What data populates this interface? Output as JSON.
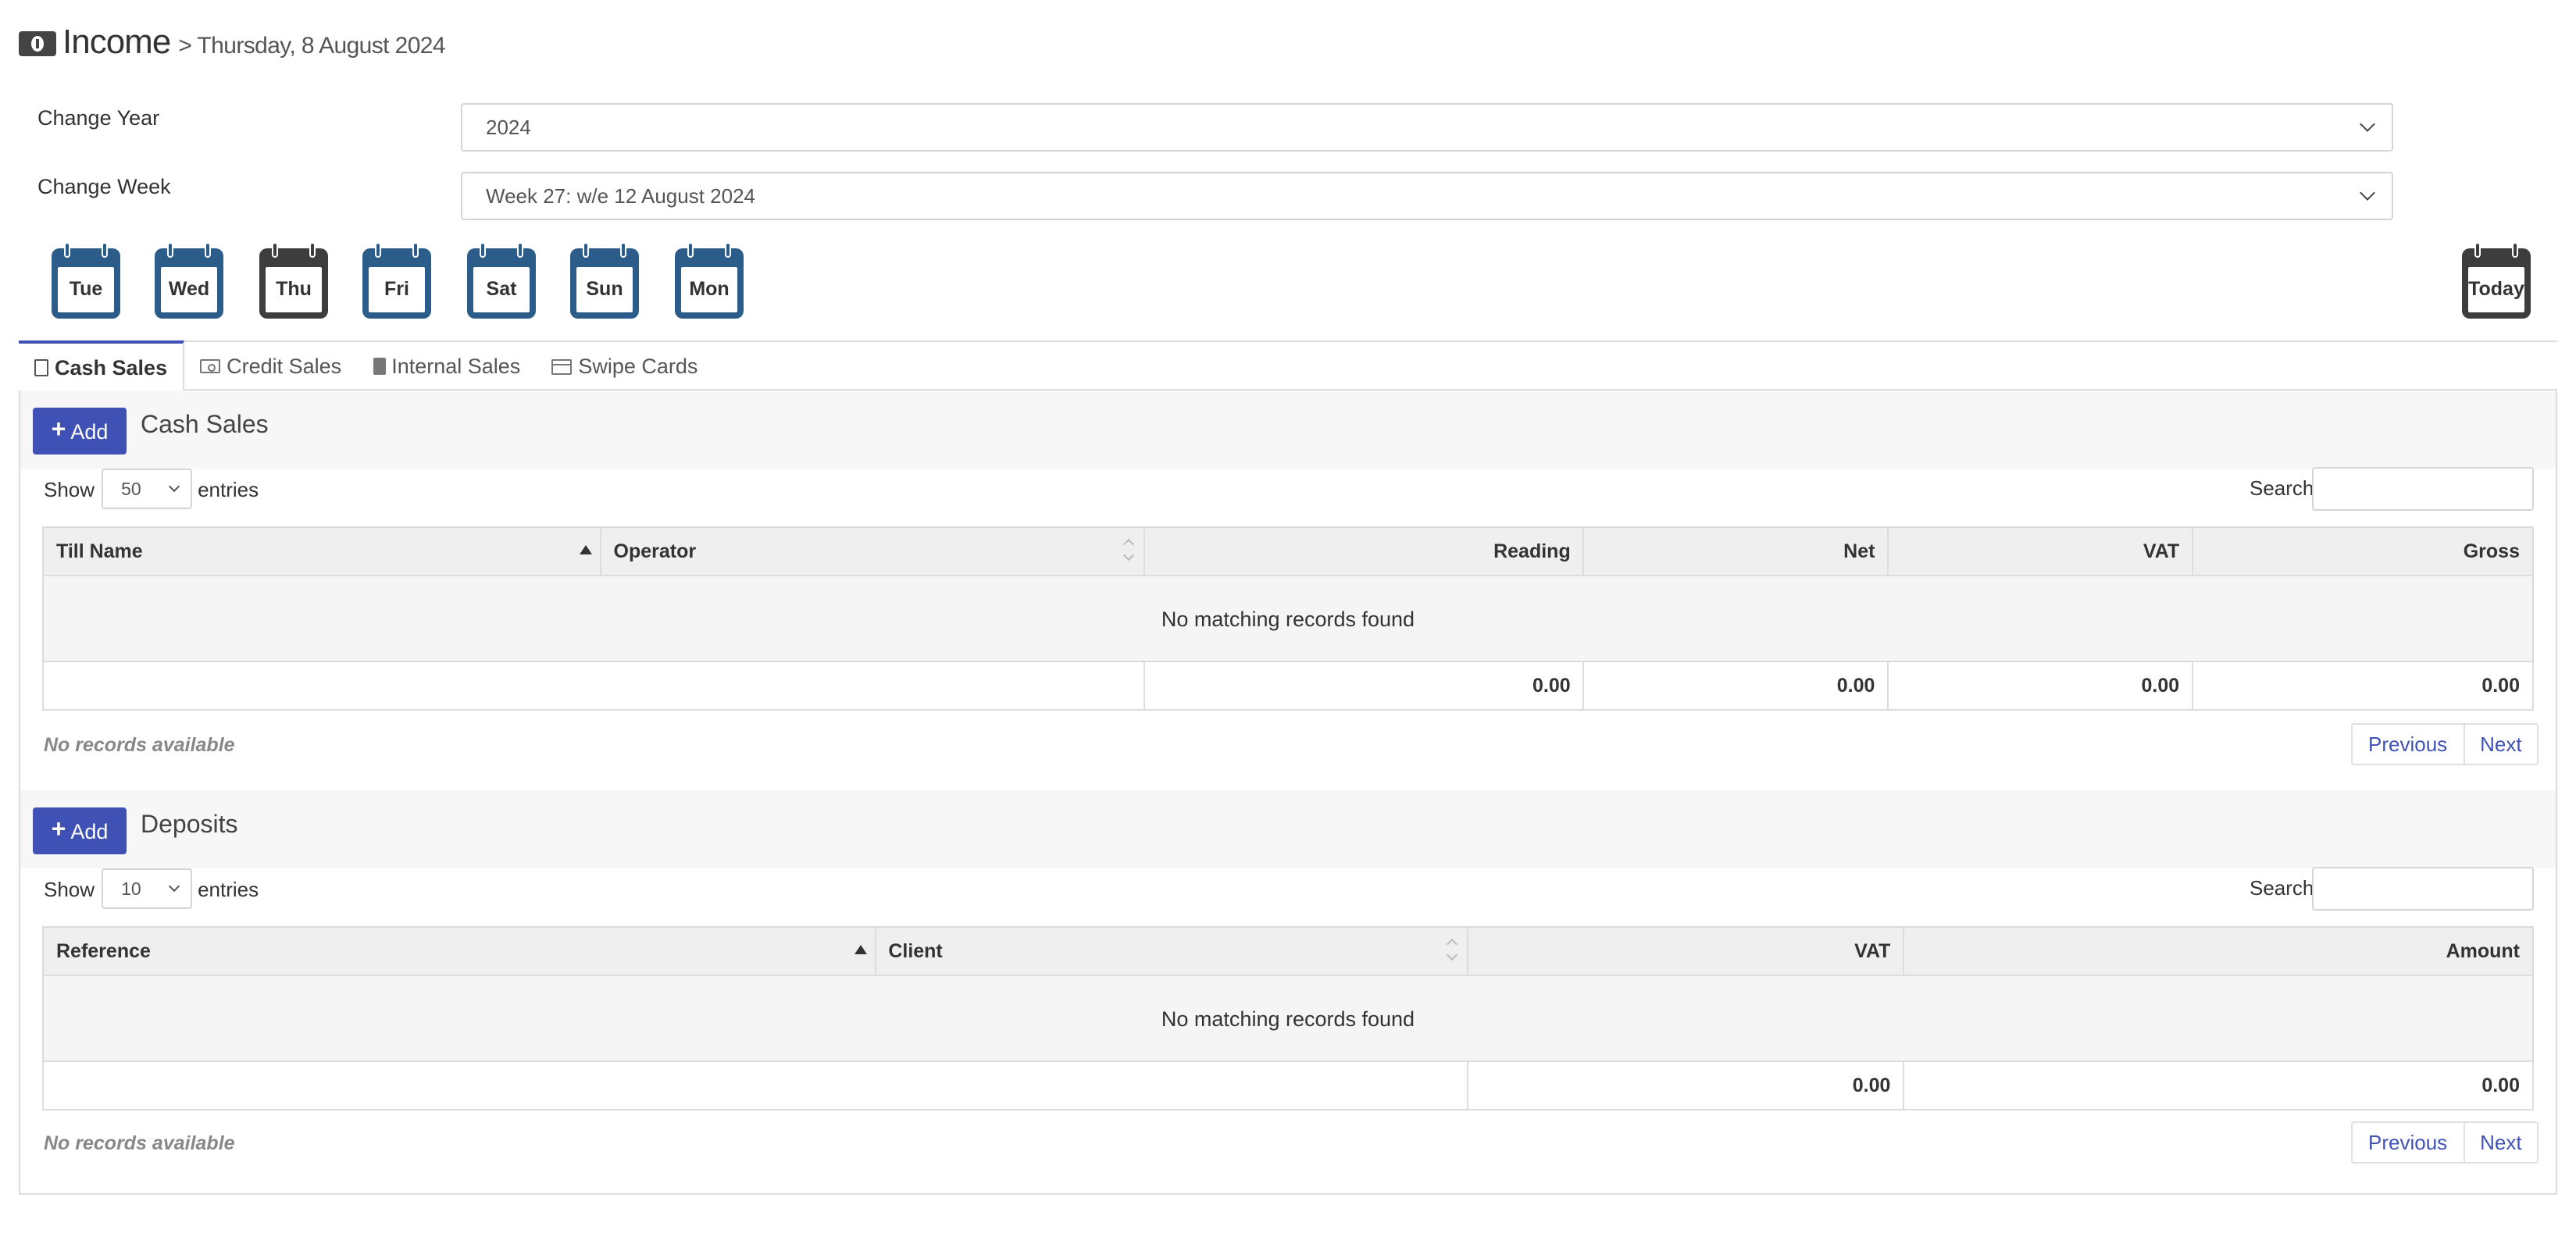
{
  "header": {
    "title": "Income",
    "subtitle": "> Thursday, 8 August 2024",
    "icon": "money-icon"
  },
  "filters": {
    "year_label": "Change Year",
    "year_value": "2024",
    "week_label": "Change Week",
    "week_value": "Week 27: w/e 12 August 2024"
  },
  "days": [
    "Tue",
    "Wed",
    "Thu",
    "Fri",
    "Sat",
    "Sun",
    "Mon"
  ],
  "today_label": "Today",
  "colors": {
    "accent": "#3f51b5",
    "calendar": "#2b5c8a",
    "calendar_active": "#3d3d3d"
  },
  "tabs": [
    {
      "label": "Cash Sales",
      "icon": "document-icon",
      "active": true
    },
    {
      "label": "Credit Sales",
      "icon": "cash-icon"
    },
    {
      "label": "Internal Sales",
      "icon": "copy-icon"
    },
    {
      "label": "Swipe Cards",
      "icon": "credit-card-icon"
    }
  ],
  "cash_sales": {
    "add_label": "Add",
    "title": "Cash Sales",
    "show_label": "Show",
    "page_length": "50",
    "entries_label": "entries",
    "search_label": "Search",
    "columns": [
      "Till Name",
      "Operator",
      "Reading",
      "Net",
      "VAT",
      "Gross"
    ],
    "empty_message": "No matching records found",
    "totals": {
      "reading": "0.00",
      "net": "0.00",
      "vat": "0.00",
      "gross": "0.00"
    },
    "info": "No records available",
    "prev_label": "Previous",
    "next_label": "Next"
  },
  "deposits": {
    "add_label": "Add",
    "title": "Deposits",
    "show_label": "Show",
    "page_length": "10",
    "entries_label": "entries",
    "search_label": "Search",
    "columns": [
      "Reference",
      "Client",
      "VAT",
      "Amount"
    ],
    "empty_message": "No matching records found",
    "totals": {
      "vat": "0.00",
      "amount": "0.00"
    },
    "info": "No records available",
    "prev_label": "Previous",
    "next_label": "Next"
  }
}
